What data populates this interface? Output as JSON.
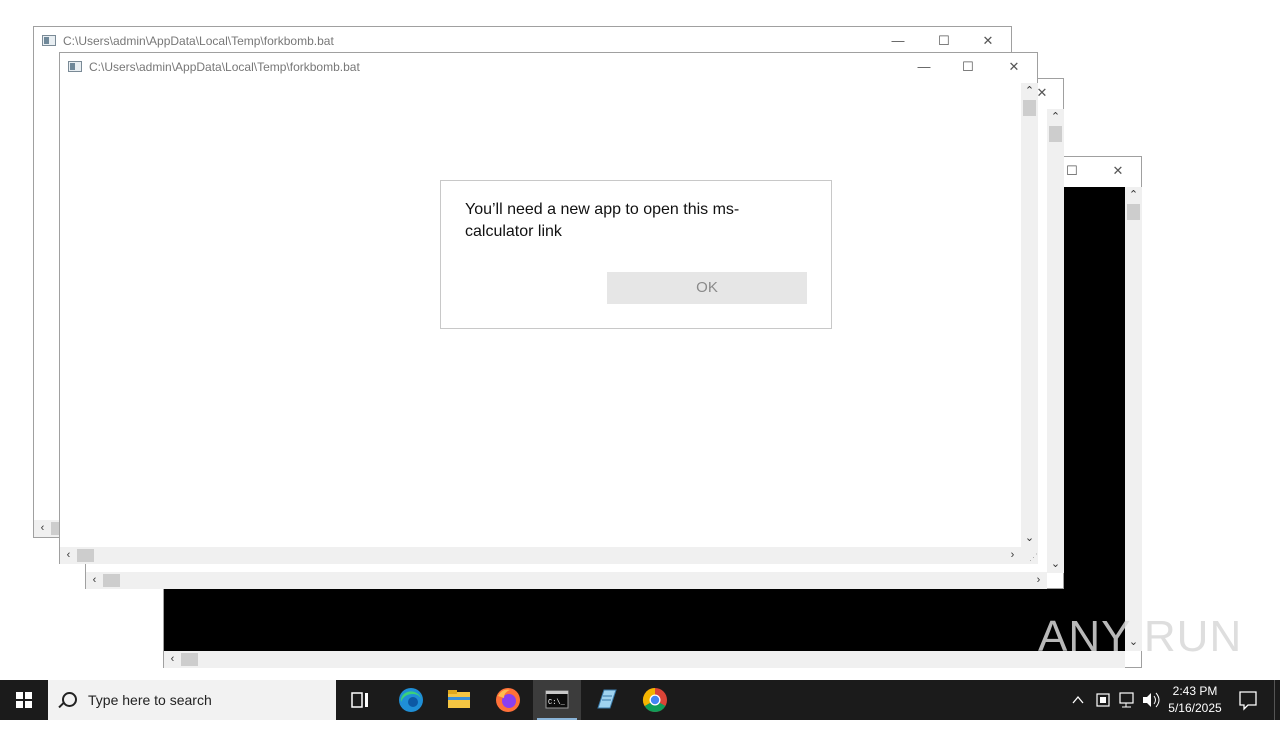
{
  "windows": {
    "back": {
      "title": "C:\\Users\\admin\\AppData\\Local\\Temp\\forkbomb.bat"
    },
    "front": {
      "title": "C:\\Users\\admin\\AppData\\Local\\Temp\\forkbomb.bat"
    }
  },
  "caption_glyphs": {
    "minimize": "—",
    "maximize": "☐",
    "close": "✕"
  },
  "scroll_glyphs": {
    "up": "⌃",
    "down": "⌄",
    "left": "‹",
    "right": "›"
  },
  "dialog": {
    "message": "You’ll need a new app to open this ms-calculator link",
    "ok_label": "OK"
  },
  "taskbar": {
    "search_placeholder": "Type here to search",
    "apps": [
      {
        "name": "task-view-icon"
      },
      {
        "name": "edge-icon"
      },
      {
        "name": "file-explorer-icon"
      },
      {
        "name": "firefox-icon"
      },
      {
        "name": "cmd-icon",
        "active": true
      },
      {
        "name": "notepad-icon"
      },
      {
        "name": "chrome-icon"
      }
    ],
    "clock_time": "2:43 PM",
    "clock_date": "5/16/2025"
  },
  "watermark": "ANY RUN",
  "colors": {
    "taskbar": "#1b1b1b",
    "console": "#000000",
    "ok_button": "#e6e6e6"
  }
}
